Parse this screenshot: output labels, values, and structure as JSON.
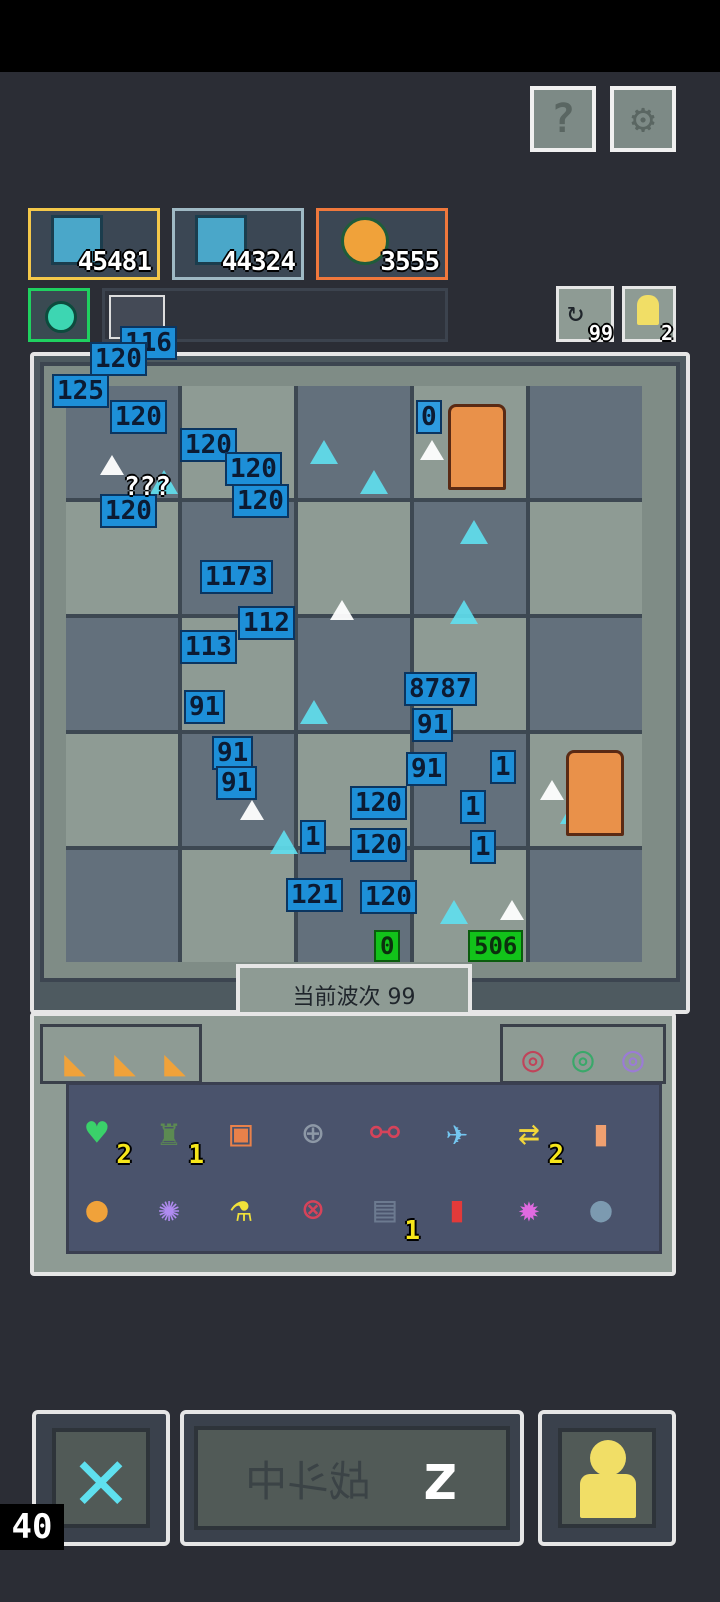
{
  "top_buttons": {
    "help": "?",
    "settings": "⚙"
  },
  "resources": [
    {
      "name": "player-1",
      "value": "45481"
    },
    {
      "name": "player-2",
      "value": "44324"
    },
    {
      "name": "fruit",
      "value": "3555"
    }
  ],
  "counters": {
    "refresh": "99",
    "pawn": "2"
  },
  "effects": {
    "unknown_label": "???"
  },
  "damage_numbers": [
    "116",
    "120",
    "125",
    "120",
    "120",
    "120",
    "120",
    "1173",
    "112",
    "113",
    "91",
    "91",
    "91",
    "8787",
    "91",
    "91",
    "120",
    "120",
    "120",
    "121",
    "120",
    "1",
    "1",
    "1",
    "1"
  ],
  "enemy_labels": {
    "top_right": "0",
    "bottom_green_1": "0",
    "bottom_green_2": "506"
  },
  "wave": {
    "label": "当前波次 99"
  },
  "panel": {
    "top_items": [
      "cheese",
      "cheese",
      "cheese"
    ],
    "rings": [
      "ring-red",
      "ring-green",
      "ring-purple"
    ],
    "row1": [
      {
        "icon": "green-heart",
        "badge": "2"
      },
      {
        "icon": "soldier",
        "badge": "1"
      },
      {
        "icon": "armor",
        "badge": ""
      },
      {
        "icon": "shield-grid",
        "badge": ""
      },
      {
        "icon": "dna",
        "badge": ""
      },
      {
        "icon": "fish",
        "badge": ""
      },
      {
        "icon": "swap",
        "badge": "2"
      },
      {
        "icon": "tombstone",
        "badge": ""
      }
    ],
    "row2": [
      {
        "icon": "fruit",
        "badge": ""
      },
      {
        "icon": "flower",
        "badge": ""
      },
      {
        "icon": "potion",
        "badge": ""
      },
      {
        "icon": "crosshair",
        "badge": ""
      },
      {
        "icon": "turret",
        "badge": "1"
      },
      {
        "icon": "battery",
        "badge": ""
      },
      {
        "icon": "gear-pink",
        "badge": ""
      },
      {
        "icon": "grenade",
        "badge": ""
      }
    ]
  },
  "bottom": {
    "fight_label": "战斗中",
    "speed": "z",
    "fps": "40"
  },
  "colors": {
    "bg": "#2b2d35",
    "tile_dark": "#63707c",
    "tile_light": "#8e9b94",
    "damage": "#1d8fd8",
    "ice": "#5fe0ef"
  }
}
